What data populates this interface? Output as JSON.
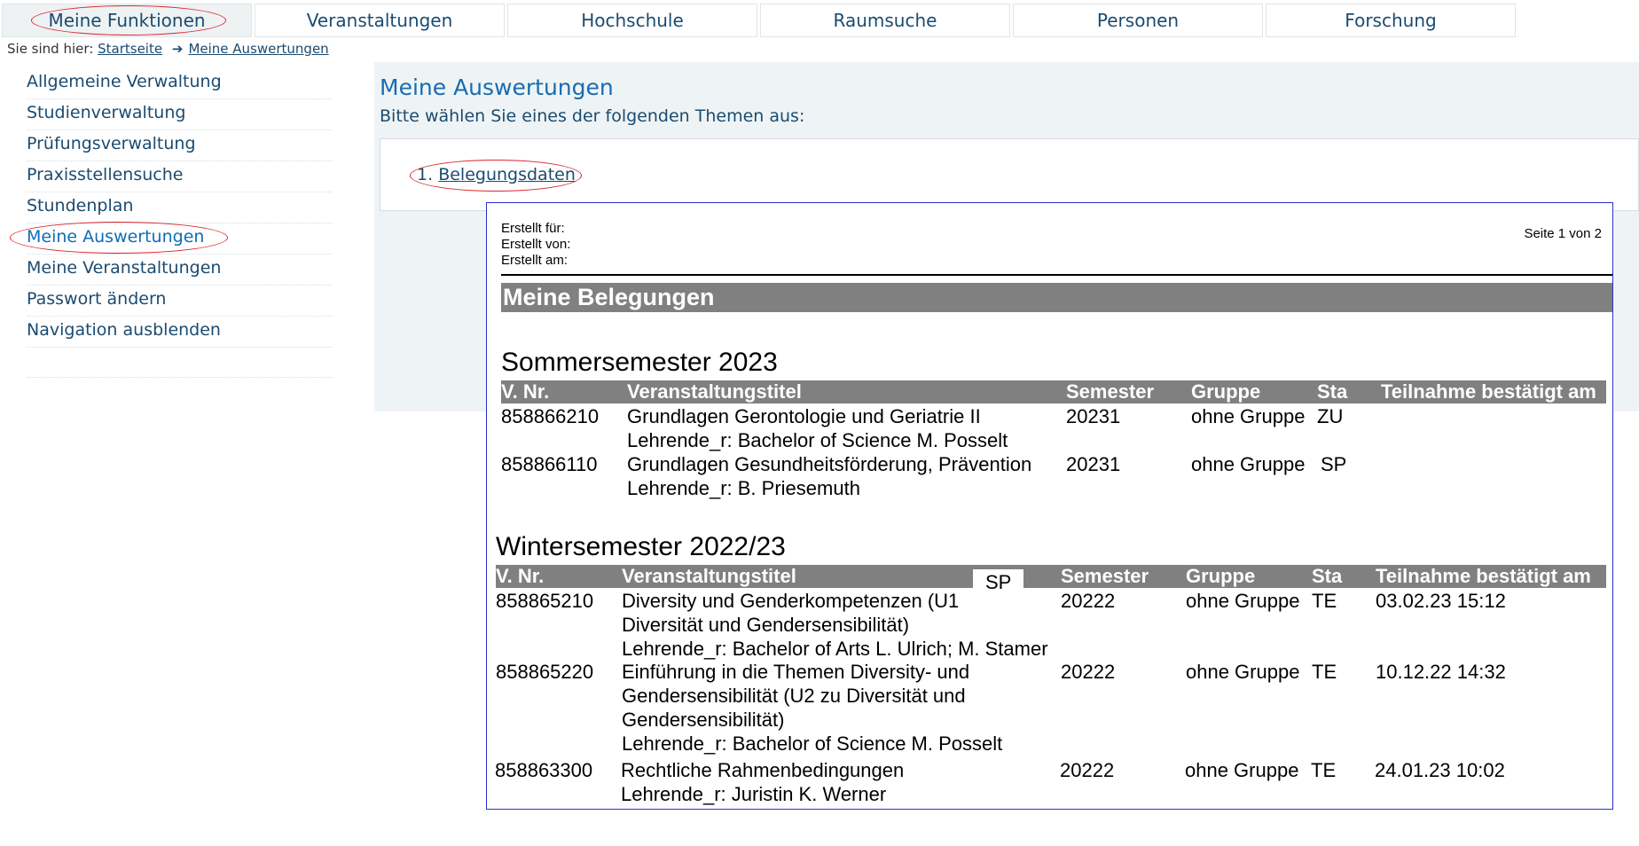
{
  "topnav": {
    "tabs": [
      {
        "label": "Meine Funktionen",
        "active": true
      },
      {
        "label": "Veranstaltungen"
      },
      {
        "label": "Hochschule"
      },
      {
        "label": "Raumsuche"
      },
      {
        "label": "Personen"
      },
      {
        "label": "Forschung"
      }
    ]
  },
  "breadcrumb": {
    "prefix": "Sie sind hier:",
    "items": [
      "Startseite",
      "Meine Auswertungen"
    ]
  },
  "sidebar": {
    "items": [
      {
        "label": "Allgemeine Verwaltung"
      },
      {
        "label": "Studienverwaltung"
      },
      {
        "label": "Prüfungsverwaltung"
      },
      {
        "label": "Praxisstellensuche"
      },
      {
        "label": "Stundenplan"
      },
      {
        "label": "Meine Auswertungen",
        "active": true
      },
      {
        "label": "Meine Veranstaltungen"
      },
      {
        "label": "Passwort ändern"
      },
      {
        "label": "Navigation ausblenden"
      }
    ]
  },
  "main": {
    "title": "Meine Auswertungen",
    "subtitle": "Bitte wählen Sie eines der folgenden Themen aus:",
    "topics": [
      {
        "number": "1.",
        "label": "Belegungsdaten"
      }
    ]
  },
  "report": {
    "meta": {
      "erstellt_fuer": "Erstellt für:",
      "erstellt_von": "Erstellt von:",
      "erstellt_am": "Erstellt am:",
      "page": "Seite 1 von 2"
    },
    "title": "Meine Belegungen",
    "columns": [
      "V. Nr.",
      "Veranstaltungstitel",
      "Semester",
      "Gruppe",
      "Sta",
      "Teilnahme bestätigt am"
    ],
    "sections": [
      {
        "title": "Sommersemester 2023",
        "rows": [
          {
            "nr": "858866210",
            "title": "Grundlagen Gerontologie und Geriatrie II",
            "lecturer": "Lehrende_r: Bachelor of Science M. Posselt",
            "semester": "20231",
            "group": "ohne Gruppe",
            "status": "ZU",
            "confirmed": ""
          },
          {
            "nr": "858866110",
            "title": "Grundlagen Gesundheitsförderung, Prävention",
            "lecturer": "Lehrende_r: B. Priesemuth",
            "semester": "20231",
            "group": "ohne Gruppe",
            "status": "SP",
            "confirmed": ""
          }
        ]
      },
      {
        "title": "Wintersemester 2022/23",
        "badge": "SP",
        "rows": [
          {
            "nr": "858865210",
            "title_lines": [
              "Diversity und Genderkompetenzen (U1",
              "Diversität und Gendersensibilität)"
            ],
            "lecturer": "Lehrende_r: Bachelor of Arts L. Ulrich; M. Stamer",
            "semester": "20222",
            "group": "ohne Gruppe",
            "status": "TE",
            "confirmed": "03.02.23 15:12"
          },
          {
            "nr": "858865220",
            "title_lines": [
              "Einführung in die Themen Diversity- und",
              "Gendersensibilität (U2 zu Diversität und",
              "Gendersensibilität)"
            ],
            "lecturer": "Lehrende_r: Bachelor of Science M. Posselt",
            "semester": "20222",
            "group": "ohne Gruppe",
            "status": "TE",
            "confirmed": "10.12.22 14:32"
          },
          {
            "nr": "858863300",
            "title_lines": [
              "Rechtliche Rahmenbedingungen"
            ],
            "lecturer": "Lehrende_r: Juristin K. Werner",
            "semester": "20222",
            "group": "ohne Gruppe",
            "status": "TE",
            "confirmed": "24.01.23 10:02"
          }
        ]
      }
    ]
  },
  "colors": {
    "nav_text": "#1b4b70",
    "link_active": "#0f6db5",
    "title_blue": "#1a6bb0",
    "panel_bg": "#eef4f5",
    "highlight_ellipse": "#d9272e",
    "report_border": "#2e2ed6",
    "report_header_bg": "#808080"
  }
}
